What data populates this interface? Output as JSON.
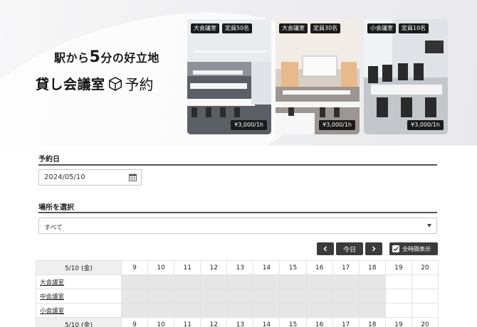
{
  "hero": {
    "tagline_pre": "駅から",
    "tagline_num": "5",
    "tagline_post": "分の好立地",
    "logo_text": "貸し会議室",
    "logo_suffix": "予約"
  },
  "rooms": [
    {
      "name": "大会議室",
      "capacity": "定員50名",
      "price": "¥3,000/1h"
    },
    {
      "name": "大会議室",
      "capacity": "定員30名",
      "price": "¥3,000/1h"
    },
    {
      "name": "小会議室",
      "capacity": "定員10名",
      "price": "¥3,000/1h"
    }
  ],
  "form": {
    "date_label": "予約日",
    "date_value": "2024/05/10",
    "place_label": "場所を選択",
    "place_value": "すべて"
  },
  "controls": {
    "prev_icon": "chevron-left-icon",
    "today_label": "今日",
    "next_icon": "chevron-right-icon",
    "show_all_label": "全時間表示",
    "show_all_checked": true
  },
  "schedule": {
    "date_header": "5/10 (金)",
    "hours": [
      "9",
      "10",
      "11",
      "12",
      "13",
      "14",
      "15",
      "16",
      "17",
      "18",
      "19",
      "20"
    ],
    "rooms": [
      "大会議室",
      "中会議室",
      "小会議室"
    ],
    "busy_until_hour_index": 10
  },
  "colors": {
    "dark_button": "#3b3b3b",
    "busy_cell": "#e6e6e6",
    "badge_bg": "#1b1b1b"
  }
}
